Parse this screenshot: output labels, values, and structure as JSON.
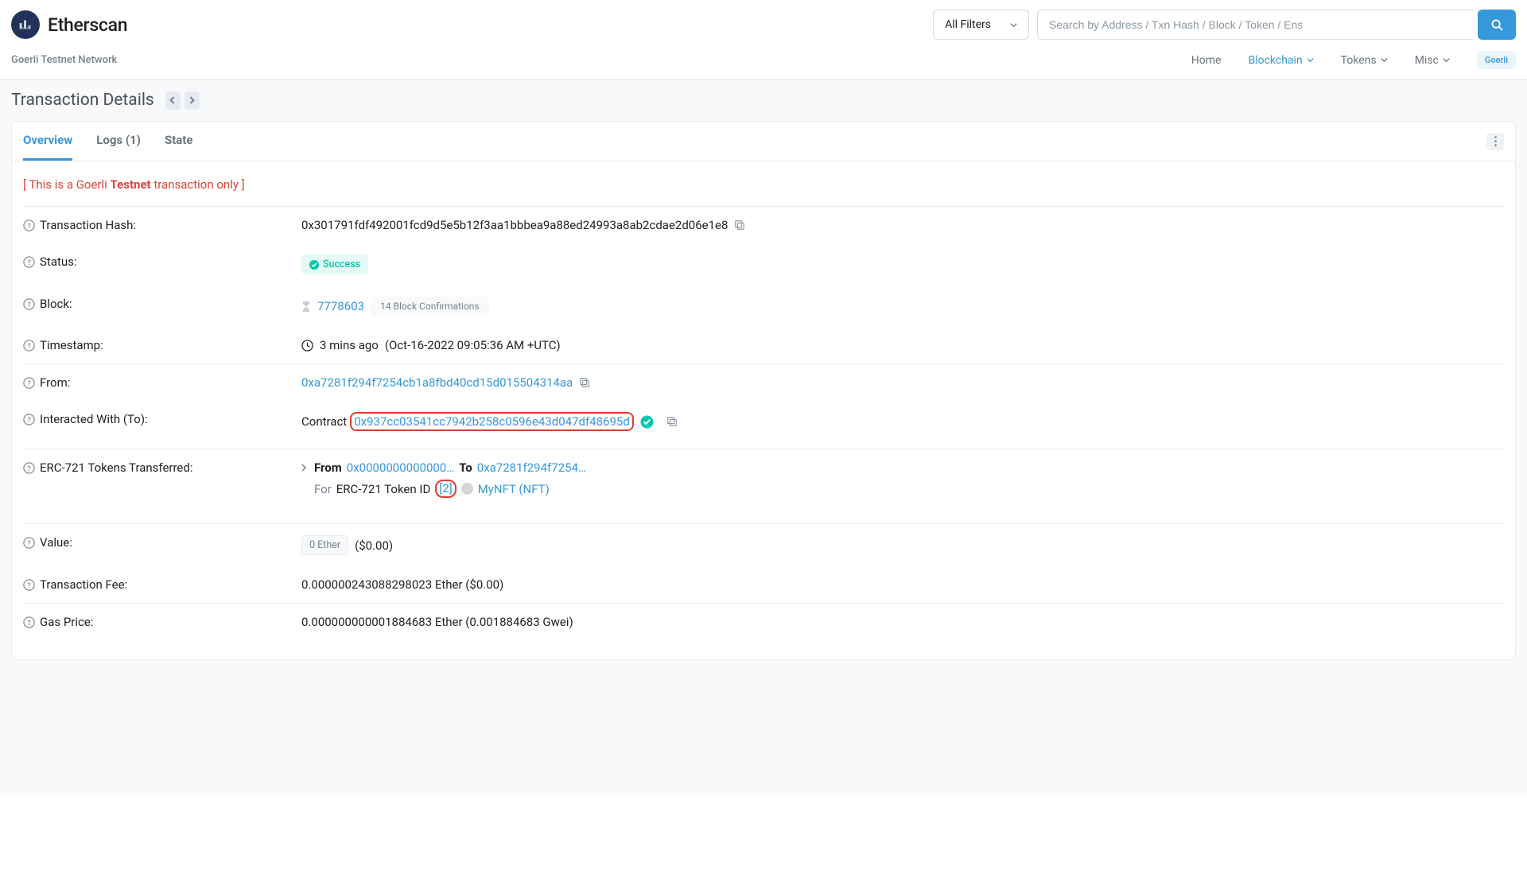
{
  "header": {
    "logo_text": "Etherscan",
    "filter_label": "All Filters",
    "search_placeholder": "Search by Address / Txn Hash / Block / Token / Ens",
    "network_label": "Goerli Testnet Network",
    "nav": {
      "home": "Home",
      "blockchain": "Blockchain",
      "tokens": "Tokens",
      "misc": "Misc"
    },
    "badge": "Goerli"
  },
  "page": {
    "title": "Transaction Details"
  },
  "tabs": {
    "overview": "Overview",
    "logs": "Logs (1)",
    "state": "State"
  },
  "warning": {
    "prefix": "[ This is a Goerli ",
    "bold": "Testnet",
    "suffix": " transaction only ]"
  },
  "labels": {
    "tx_hash": "Transaction Hash:",
    "status": "Status:",
    "block": "Block:",
    "timestamp": "Timestamp:",
    "from": "From:",
    "interacted_with": "Interacted With (To):",
    "erc721": "ERC-721 Tokens Transferred:",
    "value": "Value:",
    "tx_fee": "Transaction Fee:",
    "gas_price": "Gas Price:"
  },
  "values": {
    "tx_hash": "0x301791fdf492001fcd9d5e5b12f3aa1bbbea9a88ed24993a8ab2cdae2d06e1e8",
    "status": "Success",
    "block_number": "7778603",
    "block_confirmations": "14 Block Confirmations",
    "timestamp_ago": "3 mins ago",
    "timestamp_full": "(Oct-16-2022 09:05:36 AM +UTC)",
    "from_addr": "0xa7281f294f7254cb1a8fbd40cd15d015504314aa",
    "to_label": "Contract",
    "to_addr": "0x937cc03541cc7942b258c0596e43d047df48695d",
    "transfer": {
      "from_label": "From",
      "from_addr": "0x0000000000000…",
      "to_label": "To",
      "to_addr": "0xa7281f294f7254…",
      "for_label": "For",
      "token_type": "ERC-721 Token ID",
      "token_id": "[2]",
      "token_name": "MyNFT (NFT)"
    },
    "value_ether": "0 Ether",
    "value_usd": "($0.00)",
    "tx_fee": "0.000000243088298023 Ether ($0.00)",
    "gas_price": "0.000000000001884683 Ether (0.001884683 Gwei)"
  }
}
